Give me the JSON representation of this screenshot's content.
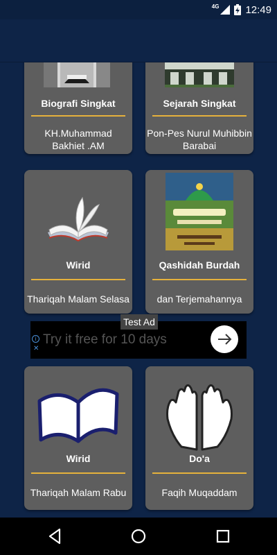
{
  "status": {
    "network": "4G",
    "time": "12:49"
  },
  "cards": [
    {
      "title": "Biografi Singkat",
      "subtitle": "KH.Muhammad Bakhiet .AM",
      "icon": "person-photo"
    },
    {
      "title": "Sejarah Singkat",
      "subtitle": "Pon-Pes Nurul Muhibbin Barabai",
      "icon": "building-photo"
    },
    {
      "title": "Wirid",
      "subtitle": "Thariqah Malam Selasa",
      "icon": "open-book-icon"
    },
    {
      "title": "Qashidah Burdah",
      "subtitle": "dan Terjemahannya",
      "icon": "burdah-cover-image"
    },
    {
      "title": "Wirid",
      "subtitle": "Thariqah Malam Rabu",
      "icon": "open-book-outline-icon"
    },
    {
      "title": "Do'a",
      "subtitle": "Faqih Muqaddam",
      "icon": "praying-hands-icon"
    }
  ],
  "ad": {
    "label": "Test Ad",
    "text": "Try it free for 10 days"
  },
  "colors": {
    "background": "#0e2447",
    "card": "#5e5e5e",
    "divider": "#e6b23c"
  }
}
